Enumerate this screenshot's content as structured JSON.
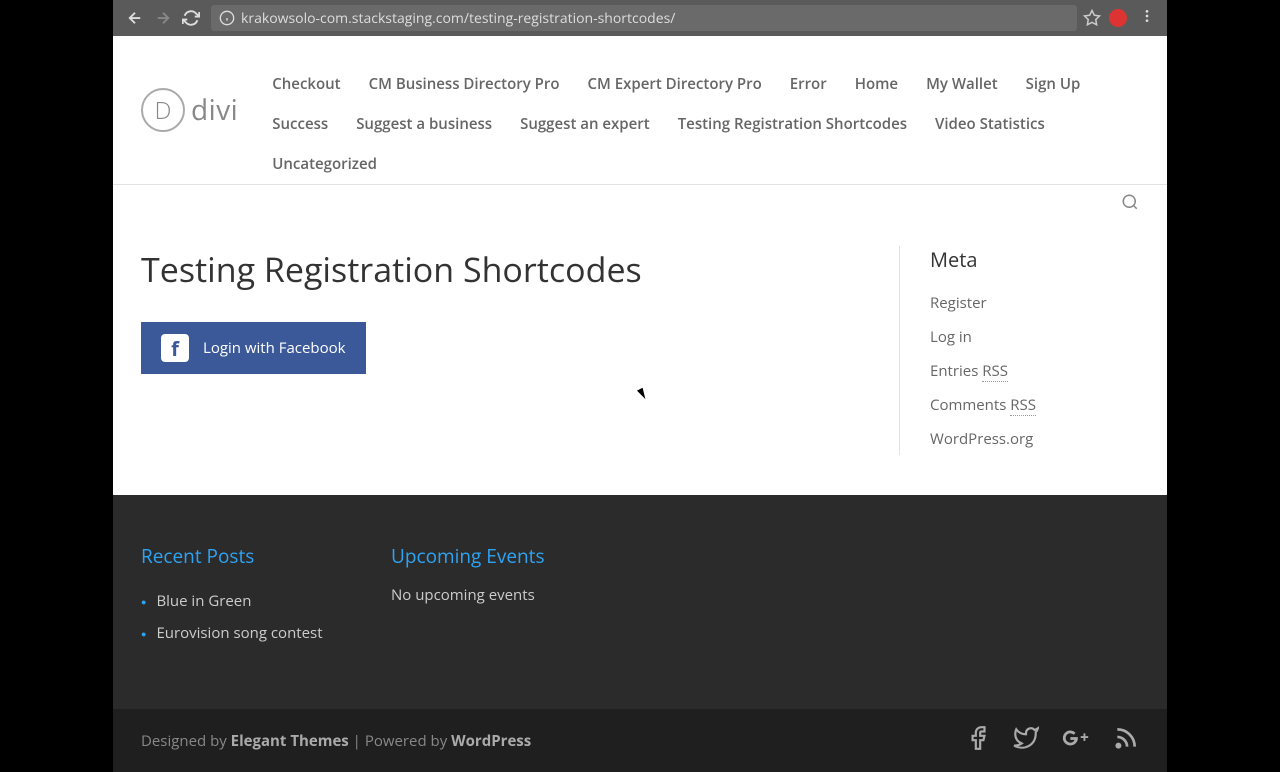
{
  "browser": {
    "url": "krakowsolo-com.stackstaging.com/testing-registration-shortcodes/"
  },
  "logo": {
    "d": "D",
    "text": "divi"
  },
  "nav": {
    "items": [
      "Checkout",
      "CM Business Directory Pro",
      "CM Expert Directory Pro",
      "Error",
      "Home",
      "My Wallet",
      "Sign Up",
      "Success",
      "Suggest a business",
      "Suggest an expert",
      "Testing Registration Shortcodes",
      "Video Statistics",
      "Uncategorized"
    ]
  },
  "page": {
    "title": "Testing Registration Shortcodes",
    "fb_button": "Login with Facebook"
  },
  "sidebar": {
    "meta_title": "Meta",
    "meta": {
      "register": "Register",
      "login": "Log in",
      "entries_prefix": "Entries ",
      "entries_rss": "RSS",
      "comments_prefix": "Comments ",
      "comments_rss": "RSS",
      "wporg": "WordPress.org"
    }
  },
  "footer": {
    "recent_title": "Recent Posts",
    "recent_posts": [
      "Blue in Green",
      "Eurovision song contest"
    ],
    "events_title": "Upcoming Events",
    "no_events": "No upcoming events",
    "designed_by": "Designed by ",
    "elegant": "Elegant Themes",
    "powered": " | Powered by ",
    "wordpress": "WordPress"
  }
}
